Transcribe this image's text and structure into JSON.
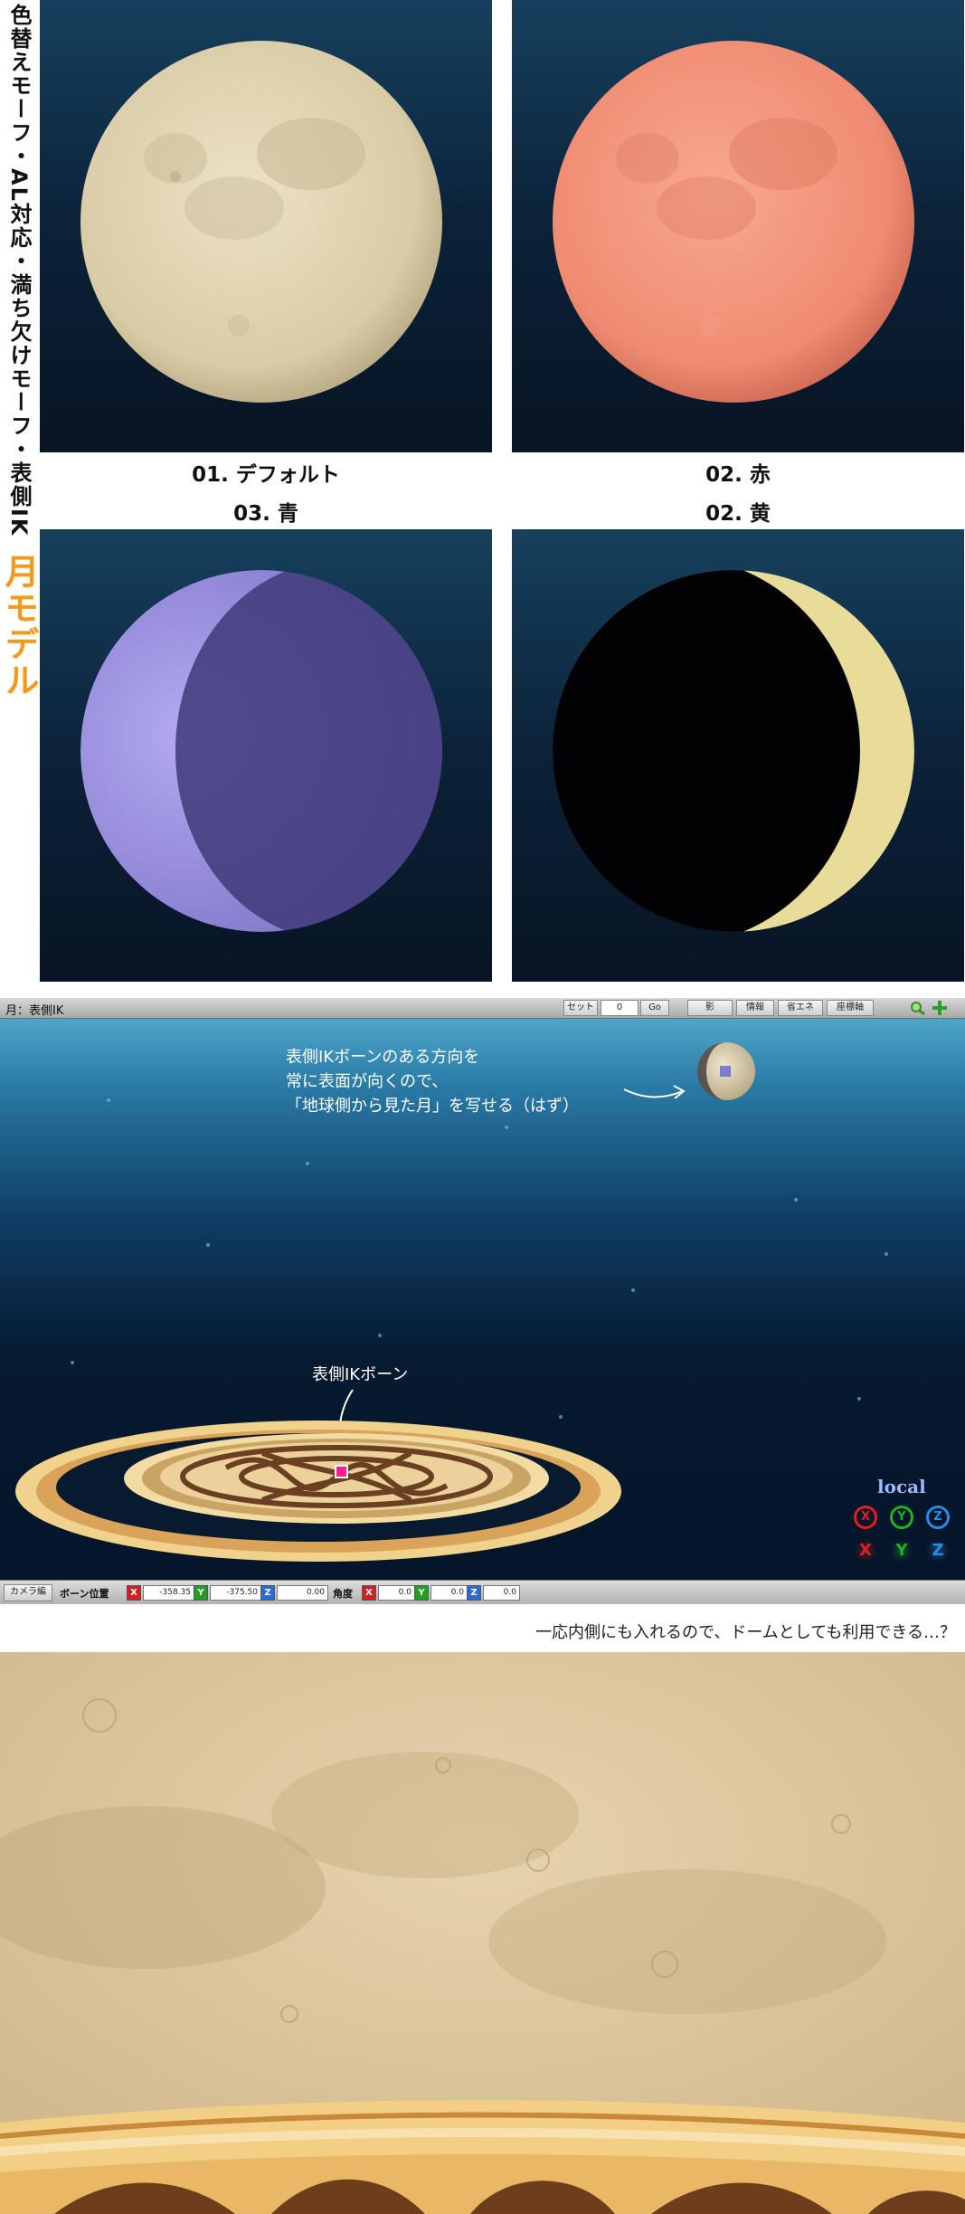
{
  "side_title": {
    "features": "色替えモーフ・AL対応・満ち欠けモーフ・表側IK",
    "name": "月モデル"
  },
  "panels": [
    {
      "caption": "01. デフォルト",
      "moon_color": "#e2d5b2"
    },
    {
      "caption": "02. 赤",
      "moon_color": "#f38f78"
    },
    {
      "caption": "03. 青",
      "moon_color": "#8d85d9"
    },
    {
      "caption": "02. 黄",
      "moon_color": "#ece09a"
    }
  ],
  "mmd": {
    "mode_label": "月：表側IK",
    "toolbar": {
      "set_label": "セット",
      "frame_value": "0",
      "go_label": "Go",
      "shadow_label": "影",
      "info_label": "情報",
      "power_save_label": "省エネ",
      "coord_label": "座標軸"
    },
    "annotation_top": [
      "表側IKボーンのある方向を",
      "常に表面が向くので、",
      "「地球側から見た月」を写せる（はず）"
    ],
    "annotation_bone": "表側IKボーン",
    "gizmo": {
      "label": "local",
      "rotate_axes": [
        "X",
        "Y",
        "Z"
      ],
      "move_axes": [
        "X",
        "Y",
        "Z"
      ],
      "colors": {
        "x": "#e02020",
        "y": "#20b020",
        "z": "#2a8ae8"
      }
    },
    "bottom": {
      "camera_btn": "カメラ編",
      "bone_pos_label": "ボーン位置",
      "pos": {
        "x": "-358.35",
        "y": "-375.50",
        "z": "0.00"
      },
      "angle_label": "角度",
      "angle": {
        "x": "0.0",
        "y": "0.0",
        "z": "0.0"
      }
    }
  },
  "lower_caption": "一応内側にも入れるので、ドームとしても利用できる…？"
}
